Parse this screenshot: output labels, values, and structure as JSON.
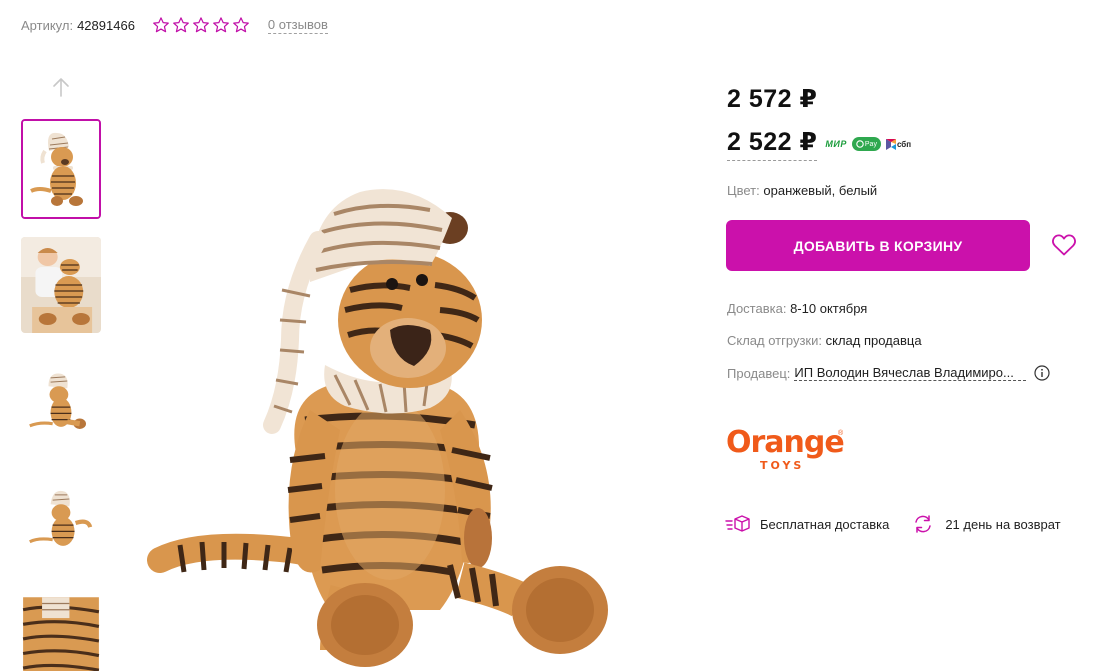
{
  "meta": {
    "sku_label": "Артикул:",
    "sku_value": "42891466",
    "rating_stars": 0,
    "reviews_label": "0 отзывов"
  },
  "product": {
    "price_old": "2 572 ₽",
    "price_new": "2 522 ₽",
    "payment_badges": {
      "mir": "МИР",
      "gpay": "Pay",
      "sbp": "сбп"
    },
    "color_label": "Цвет:",
    "color_value": "оранжевый, белый",
    "add_to_cart_label": "ДОБАВИТЬ В КОРЗИНУ",
    "delivery_label": "Доставка:",
    "delivery_value": "8-10 октября",
    "stock_label": "Склад отгрузки:",
    "stock_value": "склад продавца",
    "seller_label": "Продавец:",
    "seller_value": "ИП Володин Вячеслав Владимиро..."
  },
  "brand": {
    "name": "Orange",
    "sub": "TOYS",
    "reg": "®"
  },
  "features": [
    {
      "icon": "delivery-box-icon",
      "label": "Бесплатная доставка"
    },
    {
      "icon": "return-arrows-icon",
      "label": "21 день на возврат"
    }
  ],
  "colors": {
    "accent": "#cb11ab",
    "brand_orange": "#f05a1a",
    "muted_text": "#8a8a8a",
    "star_outline": "#c10fa8"
  },
  "gallery": {
    "thumbnails": [
      {
        "name": "thumb-tiger-front",
        "active": true
      },
      {
        "name": "thumb-boy-with-tiger",
        "active": false
      },
      {
        "name": "thumb-tiger-side",
        "active": false
      },
      {
        "name": "thumb-tiger-back",
        "active": false
      },
      {
        "name": "thumb-tiger-closeup",
        "active": false
      }
    ]
  }
}
